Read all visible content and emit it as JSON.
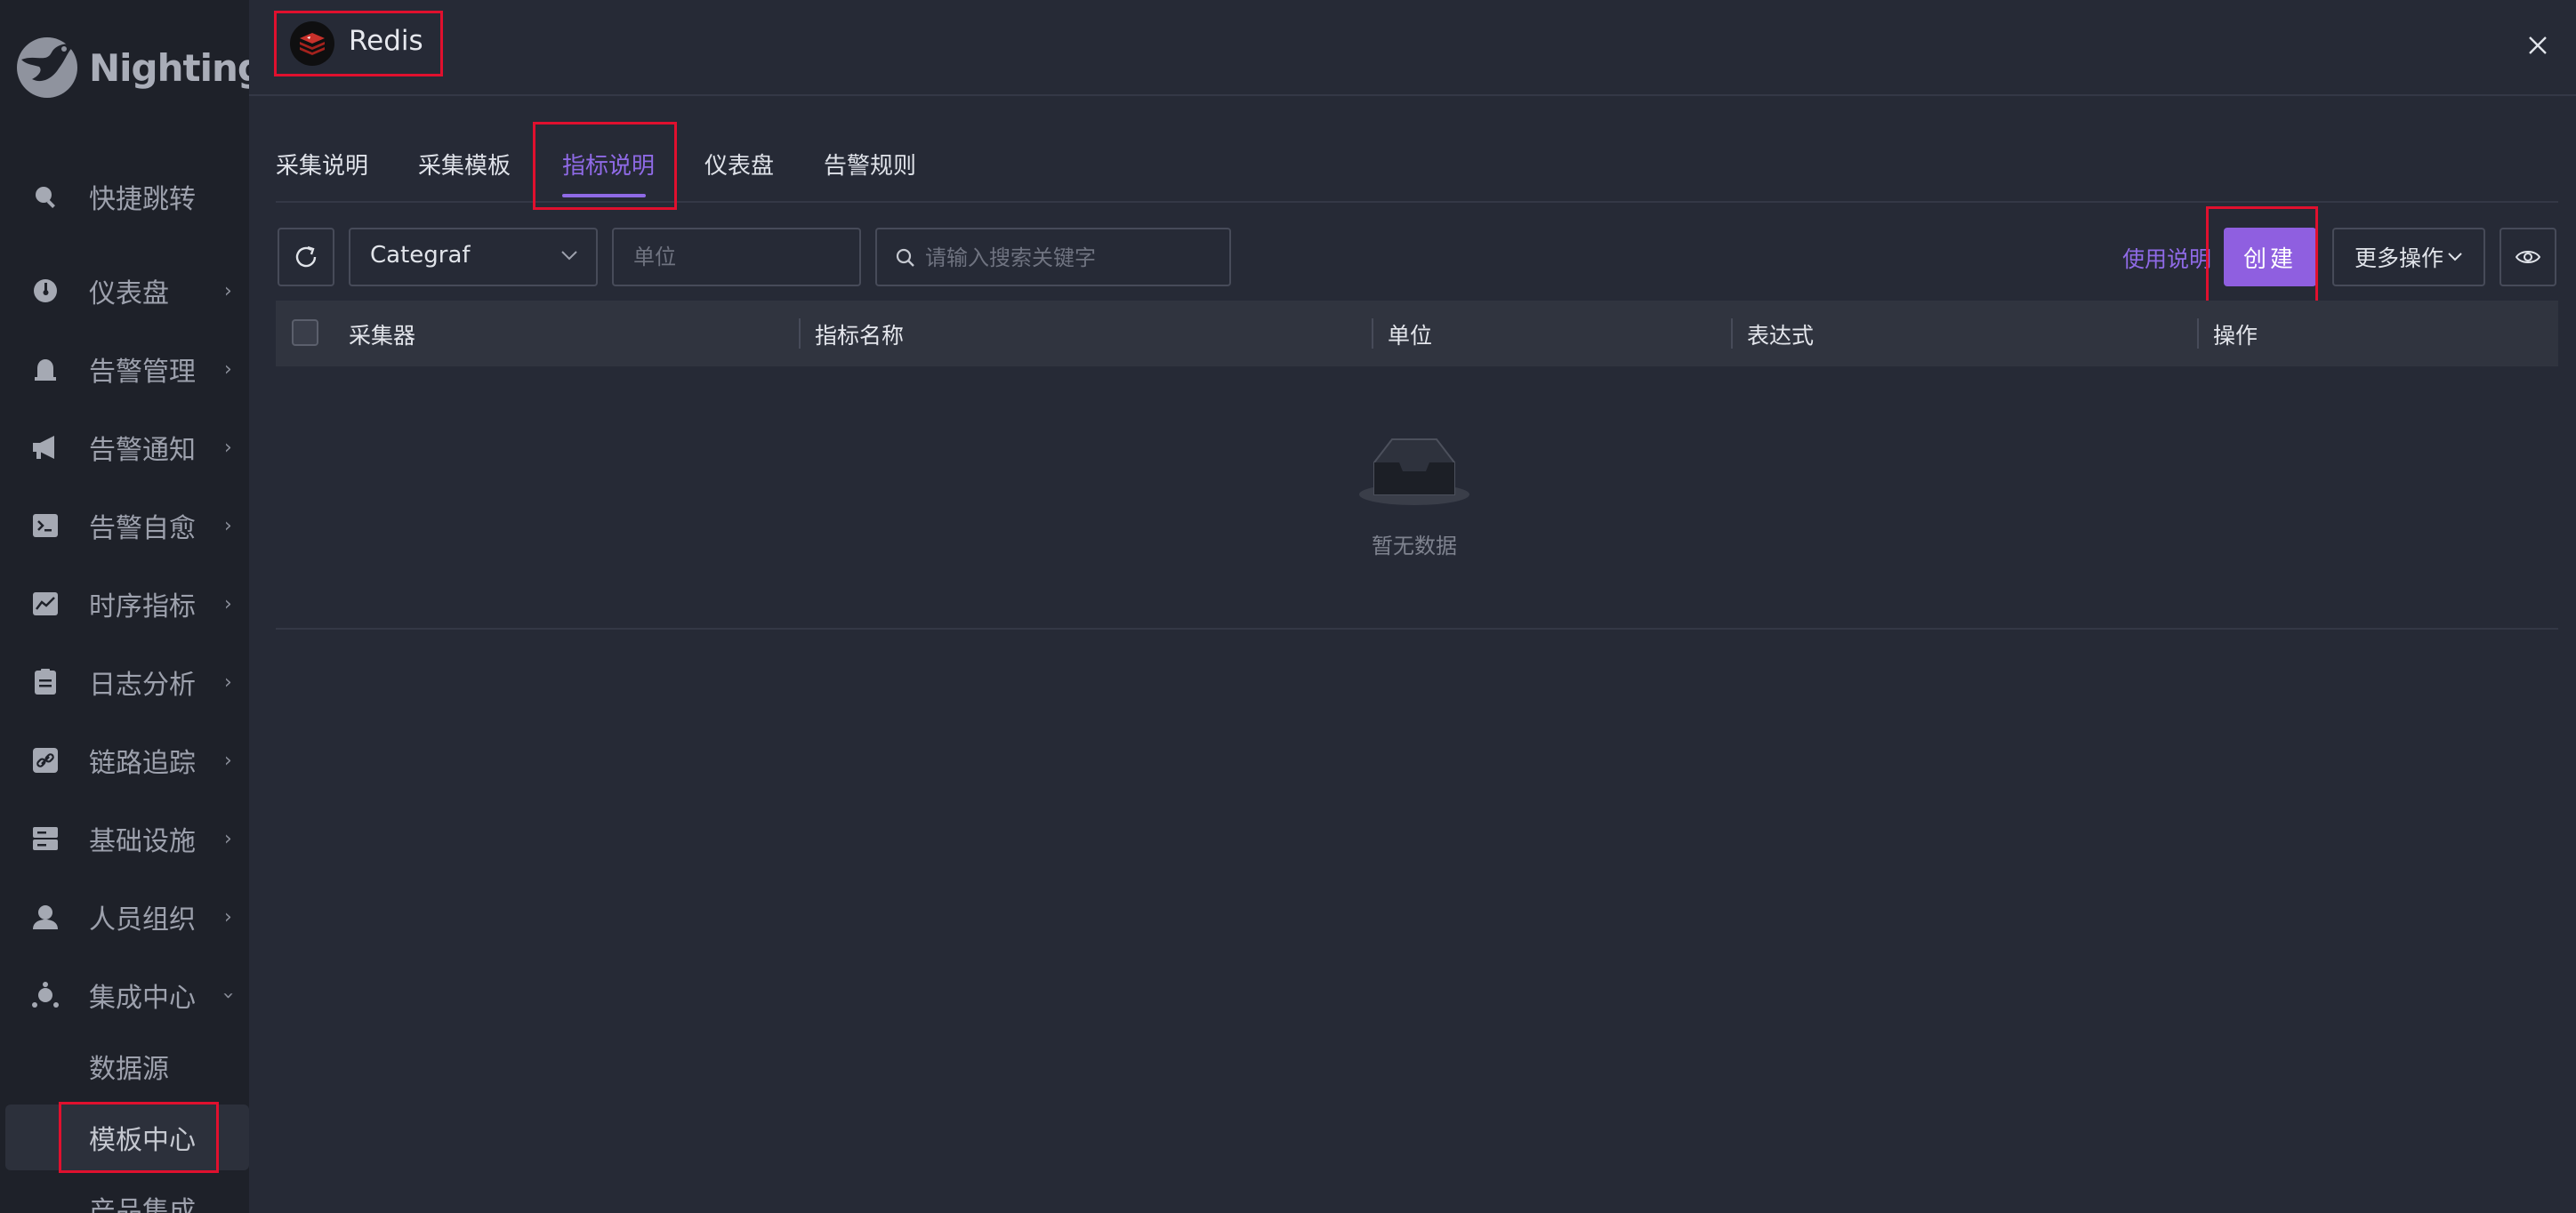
{
  "brand": {
    "name": "Nightingale"
  },
  "sidebar": {
    "items": [
      {
        "label": "快捷跳转",
        "icon": "search-icon",
        "has_arrow": false
      },
      {
        "label": "仪表盘",
        "icon": "dashboard-icon",
        "has_arrow": true
      },
      {
        "label": "告警管理",
        "icon": "alarm-icon",
        "has_arrow": true
      },
      {
        "label": "告警通知",
        "icon": "megaphone-icon",
        "has_arrow": true
      },
      {
        "label": "告警自愈",
        "icon": "terminal-icon",
        "has_arrow": true
      },
      {
        "label": "时序指标",
        "icon": "line-chart-icon",
        "has_arrow": true
      },
      {
        "label": "日志分析",
        "icon": "log-icon",
        "has_arrow": true
      },
      {
        "label": "链路追踪",
        "icon": "link-icon",
        "has_arrow": true
      },
      {
        "label": "基础设施",
        "icon": "server-icon",
        "has_arrow": true
      },
      {
        "label": "人员组织",
        "icon": "user-icon",
        "has_arrow": true
      },
      {
        "label": "集成中心",
        "icon": "integration-icon",
        "has_arrow": true,
        "expanded": true
      }
    ],
    "sub_items": [
      {
        "label": "数据源"
      },
      {
        "label": "模板中心",
        "active": true
      },
      {
        "label": "产品集成"
      }
    ]
  },
  "header": {
    "title": "Redis",
    "logo_icon": "redis-logo-icon",
    "close_icon": "close-icon"
  },
  "tabs": [
    {
      "label": "采集说明"
    },
    {
      "label": "采集模板"
    },
    {
      "label": "指标说明",
      "active": true
    },
    {
      "label": "仪表盘"
    },
    {
      "label": "告警规则"
    }
  ],
  "toolbar": {
    "collector_select": "Categraf",
    "unit_placeholder": "单位",
    "search_placeholder": "请输入搜索关键字",
    "help_label": "使用说明",
    "create_label": "创建",
    "more_label": "更多操作"
  },
  "table": {
    "columns": [
      "采集器",
      "指标名称",
      "单位",
      "表达式",
      "操作"
    ],
    "rows": [],
    "empty_text": "暂无数据"
  },
  "colors": {
    "accent": "#8f5fe0",
    "highlight_box": "#e0102e",
    "sidebar_bg": "#1e2129",
    "content_bg": "#262a36"
  }
}
